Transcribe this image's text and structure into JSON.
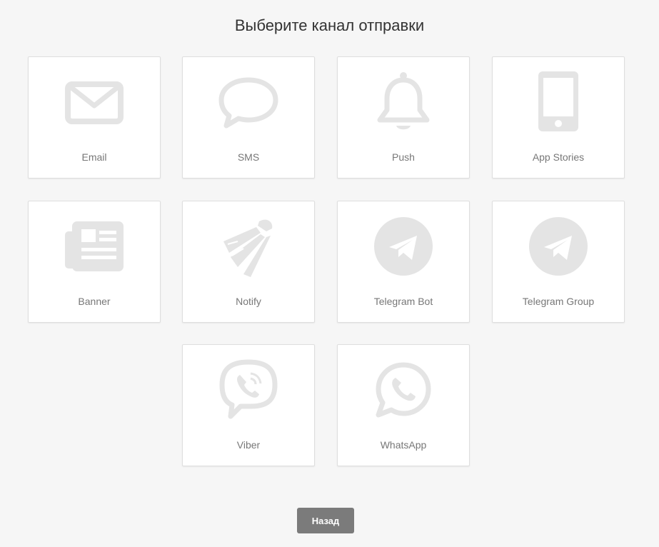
{
  "header": {
    "title": "Выберите канал отправки"
  },
  "colors": {
    "background": "#f6f6f6",
    "card": "#ffffff",
    "icon": "#e4e4e4",
    "label": "#777777",
    "button": "#7b7b7b"
  },
  "channels": [
    {
      "label": "Email",
      "icon": "envelope-icon"
    },
    {
      "label": "SMS",
      "icon": "speech-bubble-icon"
    },
    {
      "label": "Push",
      "icon": "bell-icon"
    },
    {
      "label": "App Stories",
      "icon": "mobile-phone-icon"
    },
    {
      "label": "Banner",
      "icon": "newspaper-icon"
    },
    {
      "label": "Notify",
      "icon": "shuttlecock-icon"
    },
    {
      "label": "Telegram Bot",
      "icon": "telegram-icon"
    },
    {
      "label": "Telegram Group",
      "icon": "telegram-icon"
    },
    {
      "label": "Viber",
      "icon": "viber-icon"
    },
    {
      "label": "WhatsApp",
      "icon": "whatsapp-icon"
    }
  ],
  "footer": {
    "back_label": "Назад"
  }
}
